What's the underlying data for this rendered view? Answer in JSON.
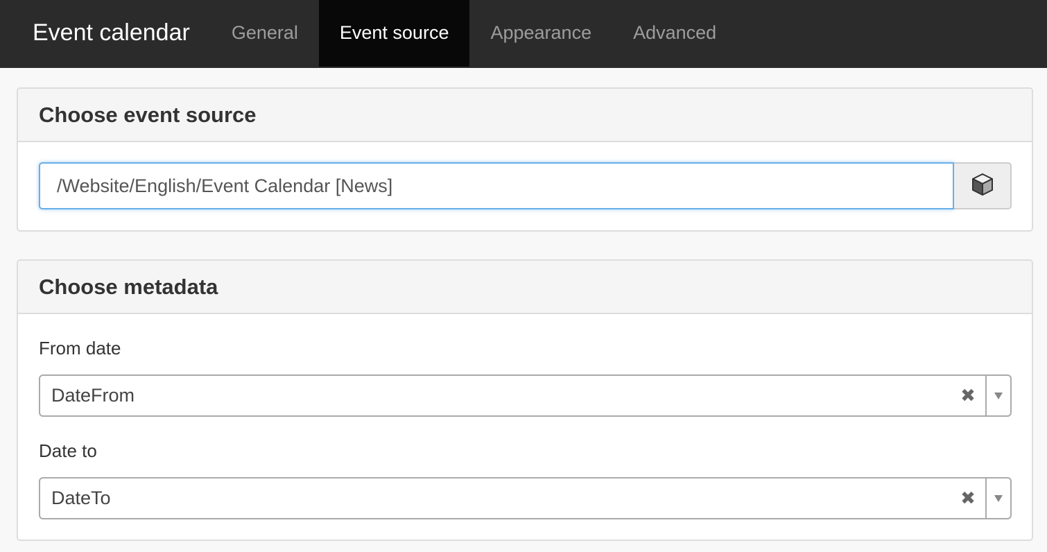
{
  "header": {
    "title": "Event calendar",
    "tabs": [
      {
        "label": "General",
        "active": false
      },
      {
        "label": "Event source",
        "active": true
      },
      {
        "label": "Appearance",
        "active": false
      },
      {
        "label": "Advanced",
        "active": false
      }
    ]
  },
  "event_source": {
    "heading": "Choose event source",
    "path_value": "/Website/English/Event Calendar [News]",
    "browse_icon": "cube-icon"
  },
  "metadata": {
    "heading": "Choose metadata",
    "from_date": {
      "label": "From date",
      "value": "DateFrom",
      "clear_glyph": "✖"
    },
    "date_to": {
      "label": "Date to",
      "value": "DateTo",
      "clear_glyph": "✖"
    }
  },
  "colors": {
    "topbar": "#2b2b2b",
    "active_tab": "#080808",
    "focus_border": "#66afe9"
  }
}
